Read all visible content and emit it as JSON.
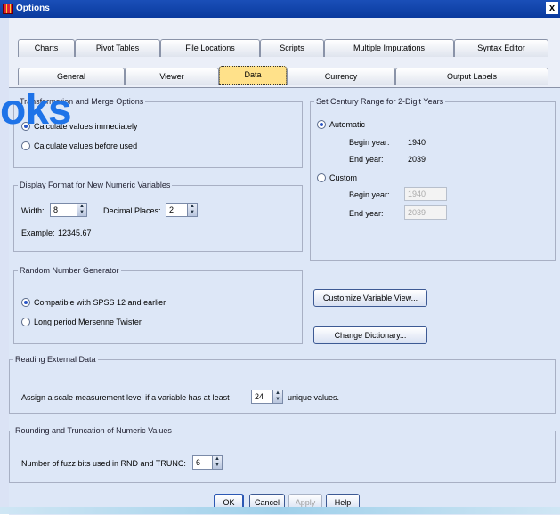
{
  "window": {
    "title": "Options",
    "close_glyph": "x"
  },
  "tabs_row1": [
    "Charts",
    "Pivot Tables",
    "File Locations",
    "Scripts",
    "Multiple Imputations",
    "Syntax Editor"
  ],
  "tabs_row2": [
    "General",
    "Viewer",
    "Data",
    "Currency",
    "Output Labels"
  ],
  "active_tab": "Data",
  "watermark": "oks",
  "transform_group": {
    "title": "Transformation and Merge Options",
    "title_visible_end": "Merge Options",
    "options": [
      "Calculate values immediately",
      "Calculate values before used"
    ],
    "selected": 0
  },
  "century_group": {
    "title": "Set Century Range for 2-Digit Years",
    "automatic_label": "Automatic",
    "begin_label": "Begin year:",
    "end_label": "End year:",
    "auto_begin": "1940",
    "auto_end": "2039",
    "custom_label": "Custom",
    "custom_begin": "1940",
    "custom_end": "2039"
  },
  "display_group": {
    "title": "Display Format for New Numeric Variables",
    "width_label": "Width:",
    "width_value": "8",
    "decimal_label": "Decimal Places:",
    "decimal_value": "2",
    "example_label": "Example:",
    "example_value": "12345.67"
  },
  "random_group": {
    "title": "Random Number Generator",
    "options": [
      "Compatible with SPSS 12 and earlier",
      "Long period Mersenne Twister"
    ],
    "selected": 0
  },
  "buttons_right": {
    "customize": "Customize Variable View...",
    "change_dict": "Change Dictionary..."
  },
  "external_group": {
    "title": "Reading External Data",
    "prefix": "Assign a scale measurement level if a variable has at least",
    "value": "24",
    "suffix": "unique values."
  },
  "rounding_group": {
    "title": "Rounding and Truncation of Numeric Values",
    "label": "Number of fuzz bits used in RND and TRUNC:",
    "value": "6"
  },
  "footer": {
    "ok": "OK",
    "cancel": "Cancel",
    "apply": "Apply",
    "help": "Help"
  },
  "colors": {
    "title_bar": "#0a3a9e",
    "active_tab": "#ffe18a",
    "panel": "#dde7f7",
    "watermark": "#1e73e8"
  },
  "icons": {
    "app": "spss-grid-icon",
    "close": "close-icon",
    "spin": "spin-arrows-icon"
  }
}
